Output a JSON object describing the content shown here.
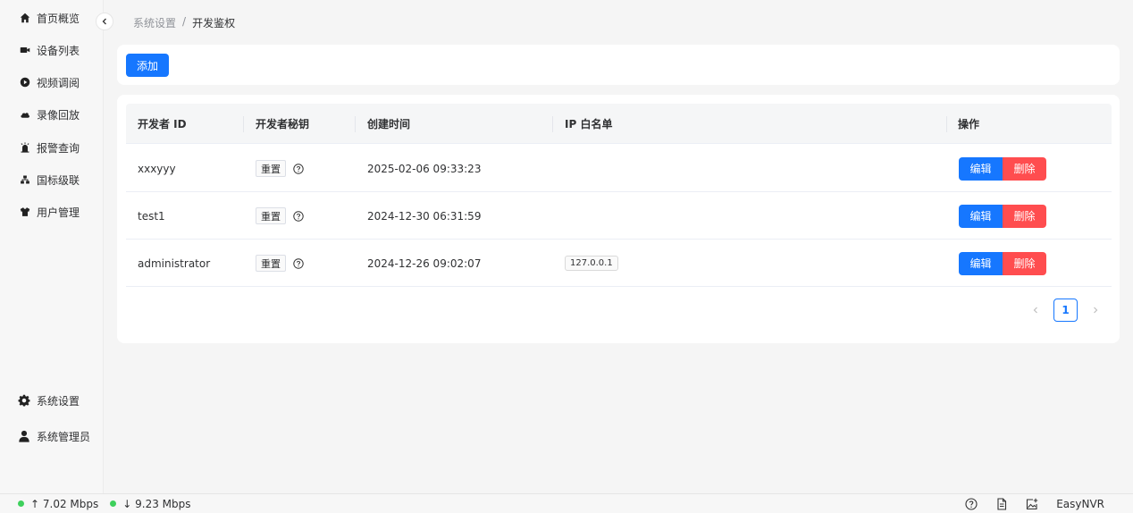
{
  "sidebar": {
    "items": [
      {
        "label": "首页概览",
        "icon": "home-icon"
      },
      {
        "label": "设备列表",
        "icon": "camera-icon"
      },
      {
        "label": "视频调阅",
        "icon": "play-icon"
      },
      {
        "label": "录像回放",
        "icon": "cloud-icon"
      },
      {
        "label": "报警查询",
        "icon": "alarm-icon"
      },
      {
        "label": "国标级联",
        "icon": "cascade-icon"
      },
      {
        "label": "用户管理",
        "icon": "shirt-icon"
      }
    ],
    "bottom_items": [
      {
        "label": "系统设置",
        "icon": "gear-icon"
      },
      {
        "label": "系统管理员",
        "icon": "user-icon"
      }
    ]
  },
  "breadcrumb": {
    "parent": "系统设置",
    "separator": "/",
    "current": "开发鉴权"
  },
  "toolbar": {
    "add_label": "添加"
  },
  "table": {
    "columns": [
      "开发者 ID",
      "开发者秘钥",
      "创建时间",
      "IP 白名单",
      "操作"
    ],
    "rows": [
      {
        "id": "xxxyyy",
        "reset": "重置",
        "created": "2025-02-06 09:33:23",
        "ip": ""
      },
      {
        "id": "test1",
        "reset": "重置",
        "created": "2024-12-30 06:31:59",
        "ip": ""
      },
      {
        "id": "administrator",
        "reset": "重置",
        "created": "2024-12-26 09:02:07",
        "ip": "127.0.0.1"
      }
    ],
    "edit_label": "编辑",
    "delete_label": "删除"
  },
  "pagination": {
    "current_page": "1"
  },
  "statusbar": {
    "upload": "↑ 7.02 Mbps",
    "download": "↓ 9.23 Mbps",
    "brand": "EasyNVR"
  },
  "colors": {
    "primary": "#1677ff",
    "danger": "#ff4d4f",
    "online": "#3ed05c"
  }
}
